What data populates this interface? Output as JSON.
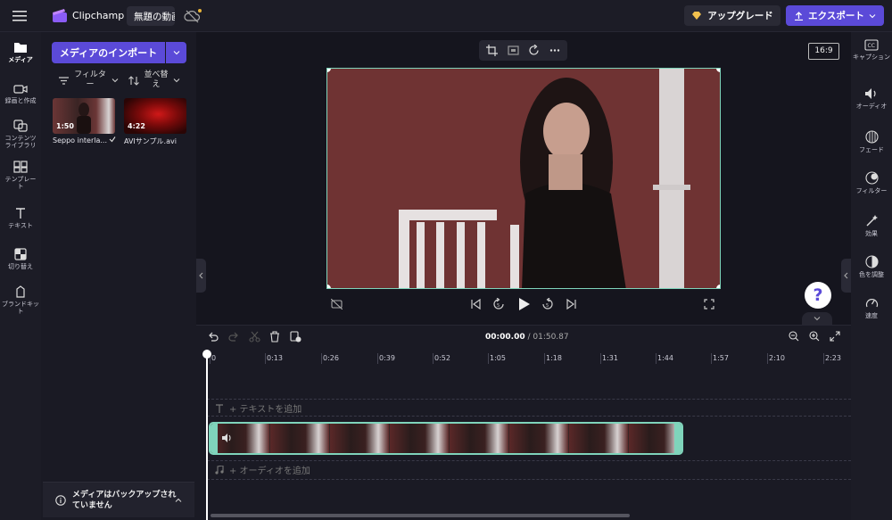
{
  "app": {
    "name": "Clipchamp",
    "project_tab": "無題の動画"
  },
  "header": {
    "upgrade_label": "アップグレード",
    "export_label": "エクスポート"
  },
  "left_nav": [
    {
      "label": "メディア",
      "icon": "folder-icon"
    },
    {
      "label": "録画と作成",
      "icon": "camera-icon"
    },
    {
      "label": "コンテンツ ライブラリ",
      "icon": "content-library-icon"
    },
    {
      "label": "テンプレート",
      "icon": "templates-icon"
    },
    {
      "label": "テキスト",
      "icon": "text-icon"
    },
    {
      "label": "切り替え",
      "icon": "transitions-icon"
    },
    {
      "label": "ブランドキット",
      "icon": "brand-kit-icon"
    }
  ],
  "media_panel": {
    "import_label": "メディアのインポート",
    "filter_label": "フィルター",
    "sort_label": "並べ替え",
    "items": [
      {
        "name": "Seppo interla...",
        "duration": "1:50"
      },
      {
        "name": "AVIサンプル.avi",
        "duration": "4:22"
      }
    ],
    "backup_text": "メディアはバックアップされていません"
  },
  "preview": {
    "aspect_ratio": "16:9"
  },
  "right_nav": [
    {
      "label": "キャプション",
      "icon": "captions-icon"
    },
    {
      "label": "オーディオ",
      "icon": "audio-icon"
    },
    {
      "label": "フェード",
      "icon": "fade-icon"
    },
    {
      "label": "フィルター",
      "icon": "filter-icon"
    },
    {
      "label": "効果",
      "icon": "effects-icon"
    },
    {
      "label": "色を調整",
      "icon": "color-icon"
    },
    {
      "label": "速度",
      "icon": "speed-icon"
    }
  ],
  "timeline": {
    "current_time": "00:00.00",
    "total_time": "/ 01:50.87",
    "ticks": [
      "0",
      "0:13",
      "0:26",
      "0:39",
      "0:52",
      "1:05",
      "1:18",
      "1:31",
      "1:44",
      "1:57",
      "2:10",
      "2:23"
    ],
    "add_text_label": "+ テキストを追加",
    "add_audio_label": "+ オーディオを追加"
  }
}
